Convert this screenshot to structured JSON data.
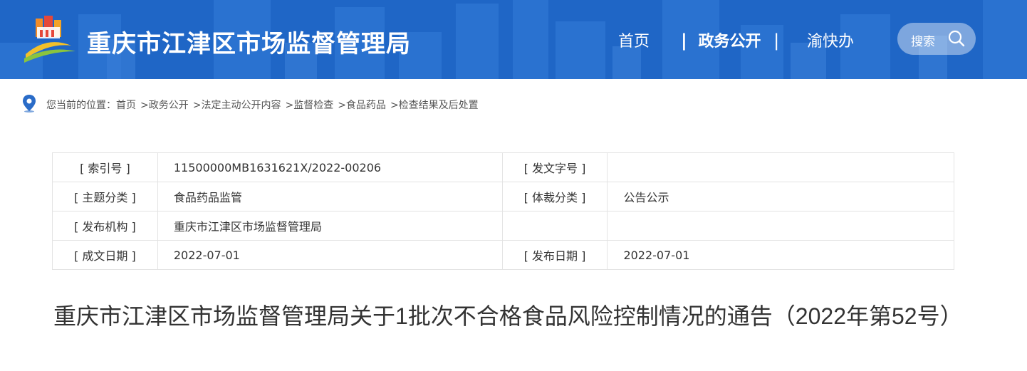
{
  "header": {
    "site_title": "重庆市江津区市场监督管理局",
    "nav": {
      "home": "首页",
      "separator": "|",
      "gov_affairs": "政务公开",
      "yukuaiban": "渝快办"
    },
    "search": {
      "label": "搜索"
    },
    "colors": {
      "bg": "#1f66c6",
      "search_bg": "rgba(255,255,255,0.42)"
    }
  },
  "breadcrumb": {
    "prefix": "您当前的位置：",
    "items": [
      "首页",
      ">政务公开",
      ">法定主动公开内容",
      ">监督检查",
      ">食品药品",
      ">检查结果及后处置"
    ]
  },
  "meta_table": {
    "rows": [
      {
        "label1": "[ 索引号 ]",
        "value1": "11500000MB1631621X/2022-00206",
        "label2": "[ 发文字号 ]",
        "value2": ""
      },
      {
        "label1": "[ 主题分类 ]",
        "value1": "食品药品监管",
        "label2": "[ 体裁分类 ]",
        "value2": "公告公示"
      },
      {
        "label1": "[ 发布机构 ]",
        "value1": "重庆市江津区市场监督管理局",
        "label2": "",
        "value2": ""
      },
      {
        "label1": "[ 成文日期 ]",
        "value1": "2022-07-01",
        "label2": "[ 发布日期 ]",
        "value2": "2022-07-01"
      }
    ]
  },
  "article": {
    "title": "重庆市江津区市场监督管理局关于1批次不合格食品风险控制情况的通告（2022年第52号）"
  }
}
